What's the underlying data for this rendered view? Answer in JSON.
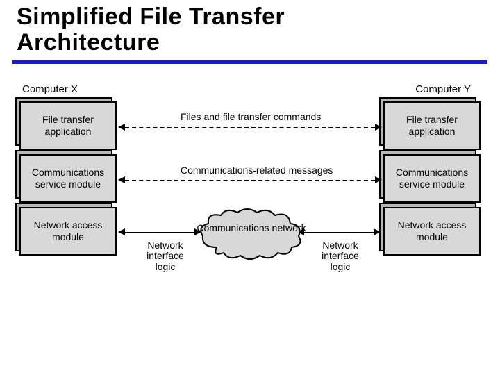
{
  "title_line1": "Simplified File Transfer",
  "title_line2": "Architecture",
  "left": {
    "name": "Computer X",
    "layers": [
      "File transfer application",
      "Communications service module",
      "Network access module"
    ]
  },
  "right": {
    "name": "Computer Y",
    "layers": [
      "File transfer application",
      "Communications service module",
      "Network access module"
    ]
  },
  "links": {
    "top": "Files and file transfer commands",
    "mid": "Communications-related messages",
    "ni_left": "Network interface logic",
    "ni_right": "Network interface logic",
    "cloud": "Communications network"
  },
  "colors": {
    "underline": "#1a1acc",
    "box_fill": "#d8d8d8",
    "box_shadow": "#b7b7b7"
  }
}
